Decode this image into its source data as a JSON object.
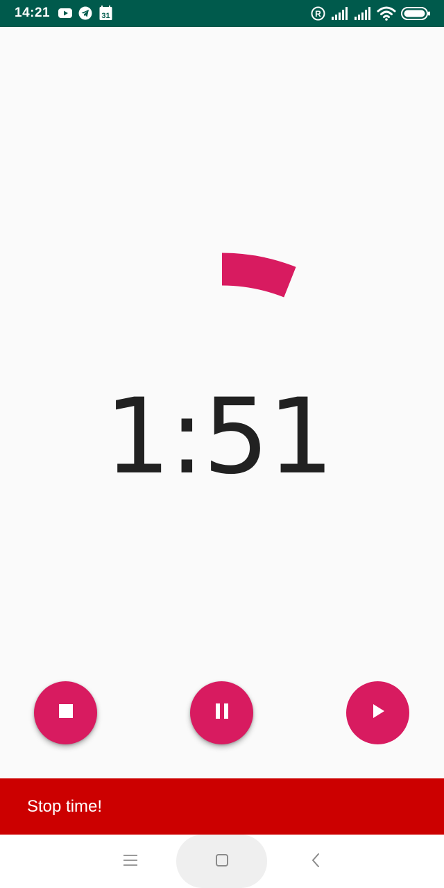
{
  "status_bar": {
    "time": "14:21",
    "calendar_day": "31",
    "roaming_label": "R",
    "icons": [
      "youtube-icon",
      "telegram-icon",
      "calendar-icon",
      "roaming-icon",
      "signal-icon",
      "signal-icon",
      "wifi-icon",
      "battery-icon"
    ]
  },
  "timer": {
    "display": "1:51",
    "progress_fraction": 0.06
  },
  "controls": {
    "stop_icon": "stop-icon",
    "pause_icon": "pause-icon",
    "play_icon": "play-icon"
  },
  "snackbar": {
    "message": "Stop time!"
  },
  "nav": {
    "icons": [
      "menu-icon",
      "home-icon",
      "back-icon"
    ]
  },
  "colors": {
    "status_bar": "#005a4c",
    "accent": "#d81b60",
    "snackbar": "#cc0000",
    "timer_text": "#212121",
    "background": "#fafafa"
  }
}
